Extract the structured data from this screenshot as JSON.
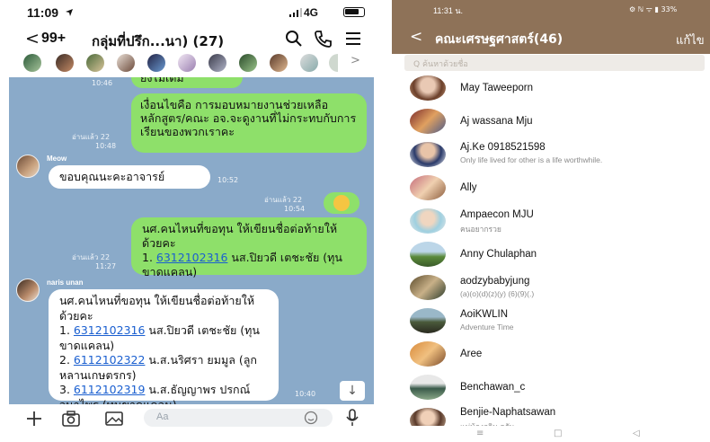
{
  "left_phone": {
    "status": {
      "time": "11:09",
      "signal": "4G"
    },
    "header": {
      "back_count": "99+",
      "title": "กลุ่มที่ปรึก...นา) (27)"
    },
    "chat": {
      "m1_fragment": "ยังไม่เต็ม",
      "m1_time": "10:46",
      "m2_text": "เงื่อนไขคือ การมอบหมายงานช่วยเหลือหลักสูตร/คณะ อจ.จะดูงานที่ไม่กระทบกับการเรียนของพวกเราคะ",
      "m2_read": "อ่านแล้ว 22",
      "m2_time": "10:48",
      "meow_name": "Meow",
      "meow_text": "ขอบคุณนะคะอาจารย์",
      "meow_time": "10:52",
      "smile_read": "อ่านแล้ว 22",
      "smile_time": "10:54",
      "m3_line1": "นศ.คนไหนที่ขอทุน ให้เขียนชื่อต่อท้ายให้ด้วยคะ",
      "m3_prefix": "1. ",
      "m3_link": "6312102316",
      "m3_rest": " นส.ปิยวดี เตชะชัย (ทุนขาดแคลน)",
      "m3_read": "อ่านแล้ว 22",
      "m3_time": "11:27",
      "naris_name": "naris unan",
      "m4_line1": "นศ.คนไหนที่ขอทุน ให้เขียนชื่อต่อท้ายให้ด้วยคะ",
      "m4_item1_prefix": "1. ",
      "m4_item1_link": "6312102316",
      "m4_item1_rest": " นส.ปิยวดี เตชะชัย (ทุนขาดแคลน)",
      "m4_item2_prefix": "2. ",
      "m4_item2_link": "6112102322",
      "m4_item2_rest": " น.ส.นริศรา ยมมูล (ลูกหลานเกษตรกร)",
      "m4_item3_prefix": "3. ",
      "m4_item3_link": "6112102319",
      "m4_item3_rest": " น.ส.ธัญญาพร ปรกณ์วนาไพร (ทุนขาดแคลน)",
      "m4_time": "10:40"
    },
    "input_placeholder": "Aa"
  },
  "right_phone": {
    "status": {
      "time": "11:31 น.",
      "right": "⚙ ℕ ᯤ ▮ 33%"
    },
    "header": {
      "back": "<",
      "title": "คณะเศรษฐศาสตร์(46)",
      "edit": "แก้ไข"
    },
    "search_placeholder": "Q ค้นหาด้วยชื่อ",
    "members": [
      {
        "name": "May Taweeporn",
        "sub": ""
      },
      {
        "name": "Aj wassana Mju",
        "sub": ""
      },
      {
        "name": "Aj.Ke 0918521598",
        "sub": "Only life lived  for other is a life worthwhile."
      },
      {
        "name": "Ally",
        "sub": ""
      },
      {
        "name": "Ampaecon MJU",
        "sub": "คนอยากรวย"
      },
      {
        "name": "Anny Chulaphan",
        "sub": ""
      },
      {
        "name": "aodzybabyjung",
        "sub": "(a)(o)(d)(z)(y) (6)(9)(.)"
      },
      {
        "name": "AoiKWLIN",
        "sub": "Adventure Time"
      },
      {
        "name": "Aree",
        "sub": ""
      },
      {
        "name": "Benchawan_c",
        "sub": ""
      },
      {
        "name": "Benjie-Naphatsawan",
        "sub": "แม่น้องกวิน  ครับ"
      }
    ]
  }
}
